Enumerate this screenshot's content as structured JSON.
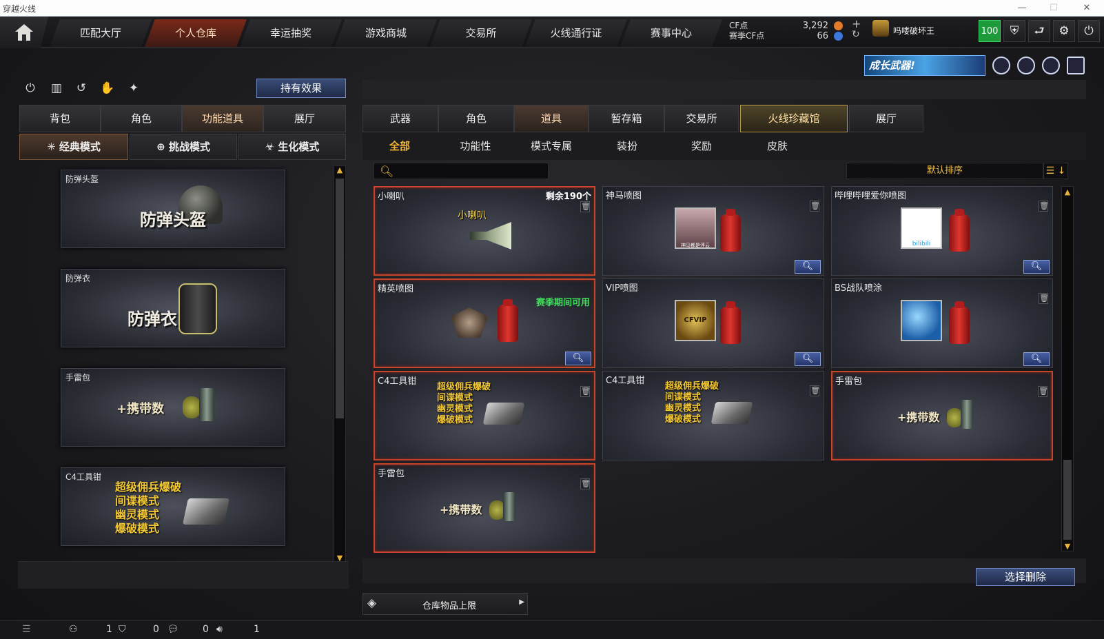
{
  "window": {
    "title": "穿越火线"
  },
  "topnav": {
    "tabs": [
      {
        "label": "匹配大厅"
      },
      {
        "label": "个人仓库"
      },
      {
        "label": "幸运抽奖"
      },
      {
        "label": "游戏商城"
      },
      {
        "label": "交易所"
      },
      {
        "label": "火线通行证"
      },
      {
        "label": "赛事中心"
      }
    ],
    "active_tab": "个人仓库",
    "cf_label": "CF点",
    "match_cf_label": "赛季CF点",
    "cf_value": "3,292",
    "match_cf_value": "66",
    "player_name": "吗喽破坏王",
    "level": "100"
  },
  "promo": {
    "label": "成长武器!"
  },
  "left": {
    "hold_effect_label": "持有效果",
    "tabs": [
      {
        "label": "背包"
      },
      {
        "label": "角色"
      },
      {
        "label": "功能道具"
      },
      {
        "label": "展厅"
      }
    ],
    "active_tab": "功能道具",
    "modes": [
      {
        "label": "经典模式"
      },
      {
        "label": "挑战模式"
      },
      {
        "label": "生化模式"
      }
    ],
    "active_mode": "经典模式",
    "items": [
      {
        "name": "防弹头盔",
        "big": "防弹头盔"
      },
      {
        "name": "防弹衣",
        "big": "防弹衣"
      },
      {
        "name": "手雷包",
        "plus": "+携带数"
      },
      {
        "name": "C4工具钳",
        "lines": [
          "超级佣兵爆破",
          "间谍模式",
          "幽灵模式",
          "爆破模式"
        ]
      }
    ]
  },
  "right": {
    "tabs": [
      {
        "label": "武器"
      },
      {
        "label": "角色"
      },
      {
        "label": "道具"
      },
      {
        "label": "暂存箱"
      },
      {
        "label": "交易所"
      },
      {
        "label": "火线珍藏馆"
      },
      {
        "label": "展厅"
      }
    ],
    "active_tab": "道具",
    "subtabs": [
      {
        "label": "全部"
      },
      {
        "label": "功能性"
      },
      {
        "label": "模式专属"
      },
      {
        "label": "装扮"
      },
      {
        "label": "奖励"
      },
      {
        "label": "皮肤"
      }
    ],
    "active_subtab": "全部",
    "search_placeholder": "",
    "sort_label": "默认排序",
    "items": [
      {
        "name": "小喇叭",
        "remaining": "剩余190个",
        "art_label": "小喇叭"
      },
      {
        "name": "神马喷图",
        "decal_label": "神马都是浮云"
      },
      {
        "name": "哔哩哔哩爱你喷图",
        "decal_label": "bilibili"
      },
      {
        "name": "精英喷图",
        "note": "赛季期间可用"
      },
      {
        "name": "VIP喷图",
        "decal_label": "CFVIP"
      },
      {
        "name": "BS战队喷涂"
      },
      {
        "name": "C4工具钳",
        "lines": [
          "超级佣兵爆破",
          "间谍模式",
          "幽灵模式",
          "爆破模式"
        ]
      },
      {
        "name": "C4工具钳",
        "lines": [
          "超级佣兵爆破",
          "间谍模式",
          "幽灵模式",
          "爆破模式"
        ]
      },
      {
        "name": "手雷包",
        "plus": "+携带数"
      },
      {
        "name": "手雷包",
        "plus": "+携带数"
      }
    ],
    "delete_select_label": "选择删除",
    "storage_limit_label": "仓库物品上限"
  },
  "statusbar": {
    "counts": [
      "1",
      "0",
      "0",
      "1"
    ]
  },
  "colors": {
    "accent_gold": "#f0b53a",
    "selected_border": "#c6462c",
    "level_green": "#1d9b3a",
    "button_blue": "#3c4e7b"
  }
}
